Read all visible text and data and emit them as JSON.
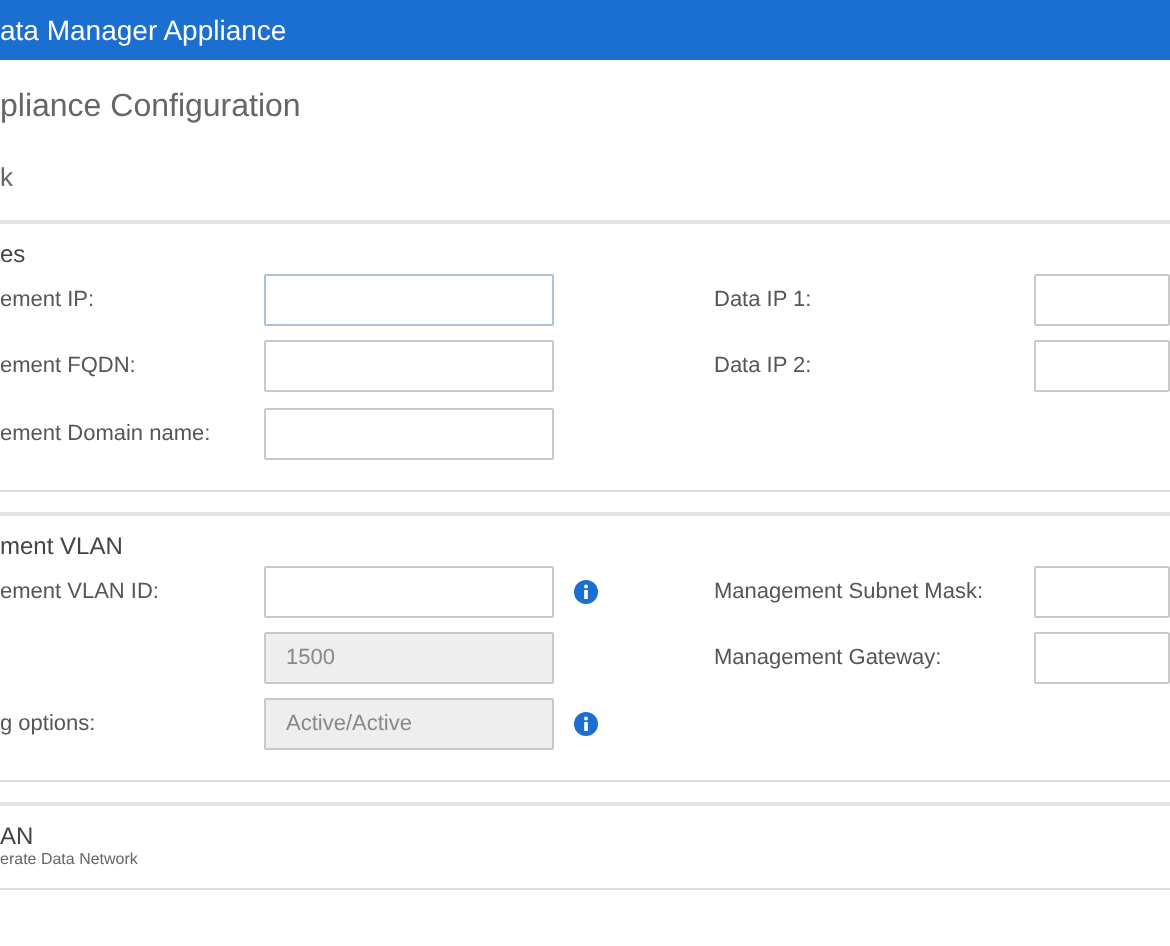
{
  "header": {
    "title": "ata Manager Appliance"
  },
  "page": {
    "title": "pliance Configuration",
    "tab": "k"
  },
  "sections": [
    {
      "title": "es",
      "rows": [
        {
          "left": {
            "label": "ement IP:",
            "disabled": false,
            "focused": true,
            "info": false
          },
          "right": {
            "label": "Data IP 1:"
          }
        },
        {
          "left": {
            "label": "ement FQDN:",
            "disabled": false,
            "focused": false,
            "info": false
          },
          "right": {
            "label": "Data IP 2:"
          }
        },
        {
          "left": {
            "label": "ement Domain name:",
            "disabled": false,
            "focused": false,
            "info": false
          }
        }
      ]
    },
    {
      "title": "ment VLAN",
      "rows": [
        {
          "left": {
            "label": "ement VLAN ID:",
            "disabled": false,
            "focused": false,
            "info": true
          },
          "right": {
            "label": "Management Subnet Mask:"
          }
        },
        {
          "left": {
            "value": "1500",
            "disabled": true,
            "focused": false,
            "info": false
          },
          "right": {
            "label": "Management Gateway:"
          }
        },
        {
          "left": {
            "label": "g options:",
            "value": "Active/Active",
            "disabled": true,
            "focused": false,
            "info": true
          }
        }
      ]
    },
    {
      "title": "AN",
      "subtitle": "erate Data Network"
    }
  ]
}
